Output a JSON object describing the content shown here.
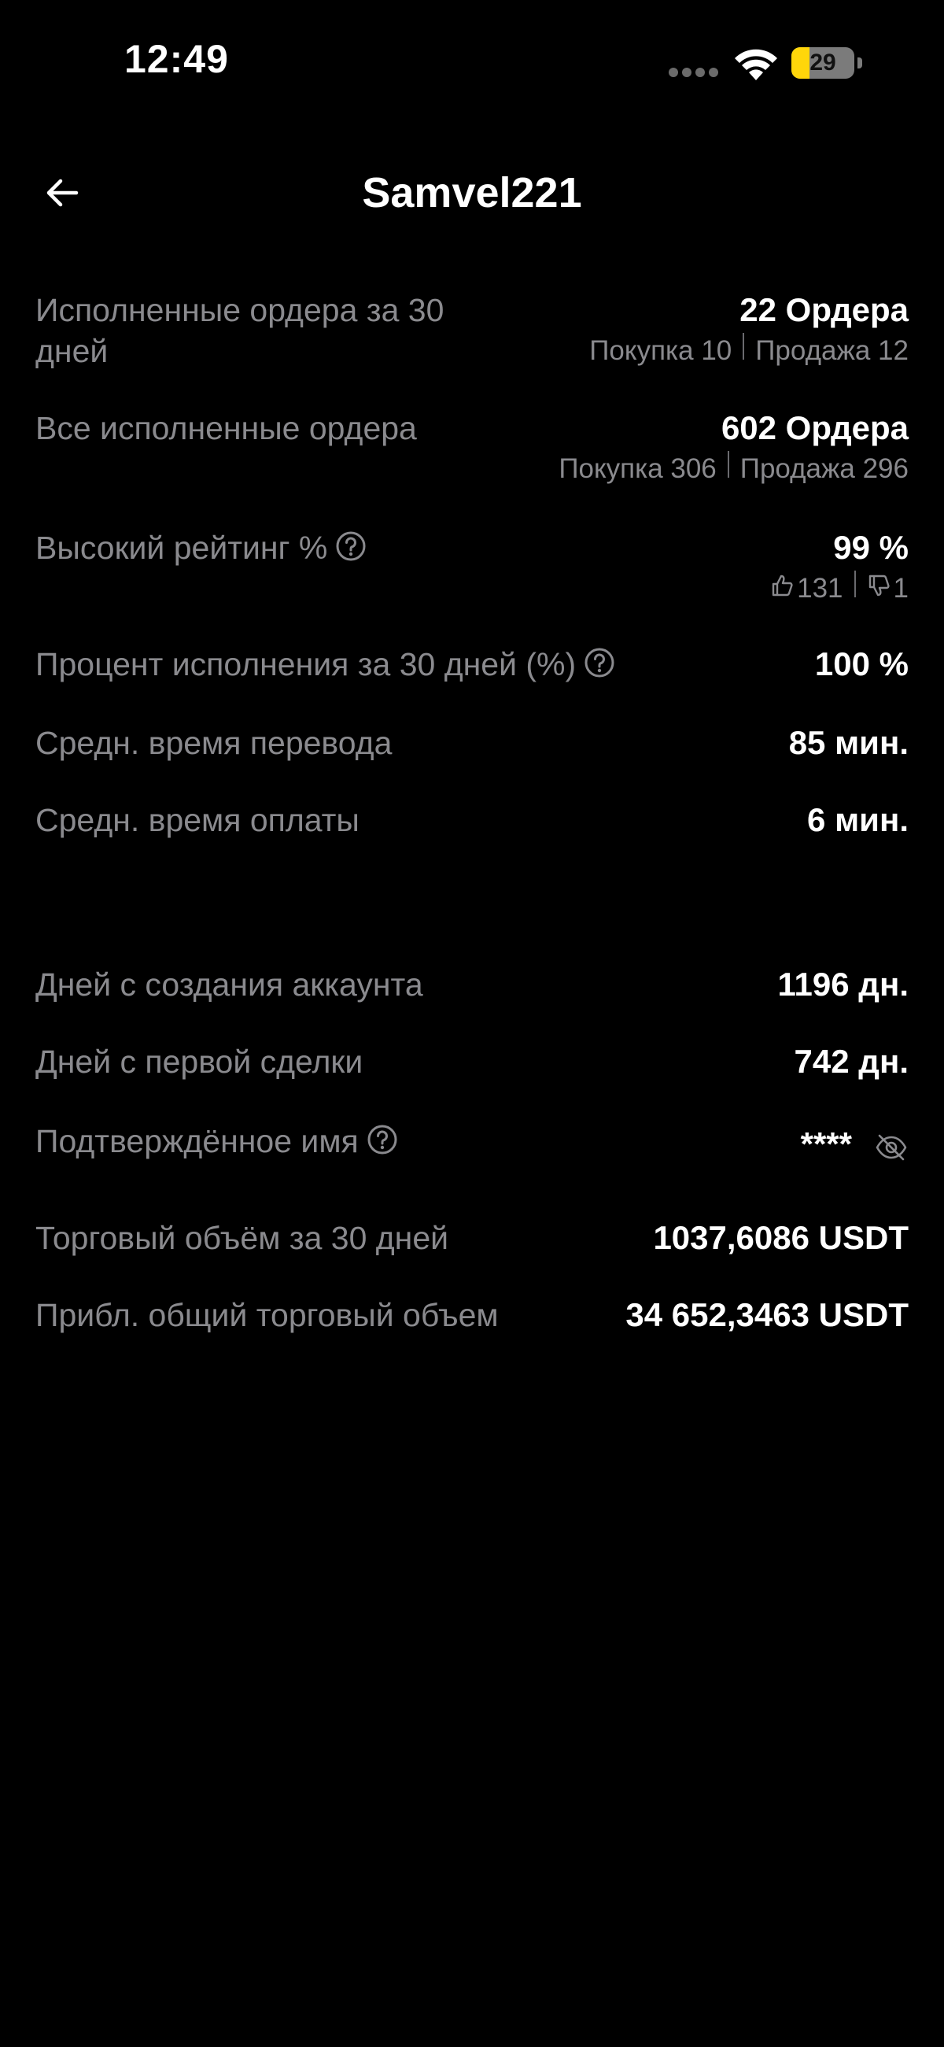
{
  "status_bar": {
    "time": "12:49",
    "battery_level": "29",
    "battery_fraction": 0.29,
    "icons": [
      "cellular-signal-icon",
      "wifi-icon",
      "battery-icon"
    ]
  },
  "header": {
    "title": "Samvel221",
    "back_icon": "arrow-left-icon"
  },
  "stats": {
    "orders_30d": {
      "label": "Исполненные ордера за 30 дней",
      "value": "22 Ордера",
      "buy": "Покупка 10",
      "sell": "Продажа 12"
    },
    "orders_total": {
      "label": "Все исполненные ордера",
      "value": "602 Ордера",
      "buy": "Покупка 306",
      "sell": "Продажа 296"
    },
    "rating": {
      "label": "Высокий рейтинг %",
      "value": "99 %",
      "likes": "131",
      "dislikes": "1"
    },
    "completion_30d": {
      "label": "Процент исполнения за 30 дней (%)",
      "value": "100 %"
    },
    "avg_transfer_time": {
      "label": "Средн. время перевода",
      "value": "85 мин."
    },
    "avg_payment_time": {
      "label": "Средн. время оплаты",
      "value": "6 мин."
    },
    "account_age": {
      "label": "Дней с создания аккаунта",
      "value": "1196 дн."
    },
    "first_trade_age": {
      "label": "Дней с первой сделки",
      "value": "742 дн."
    },
    "verified_name": {
      "label": "Подтверждённое имя",
      "value": "****"
    },
    "volume_30d": {
      "label": "Торговый объём за 30 дней",
      "value": "1037,6086 USDT"
    },
    "volume_total": {
      "label": "Прибл. общий торговый объем",
      "value": "34 652,3463 USDT"
    }
  },
  "colors": {
    "background": "#000000",
    "text_primary": "#ffffff",
    "text_secondary": "#8a8a8e",
    "battery_accent": "#ffd60a"
  }
}
